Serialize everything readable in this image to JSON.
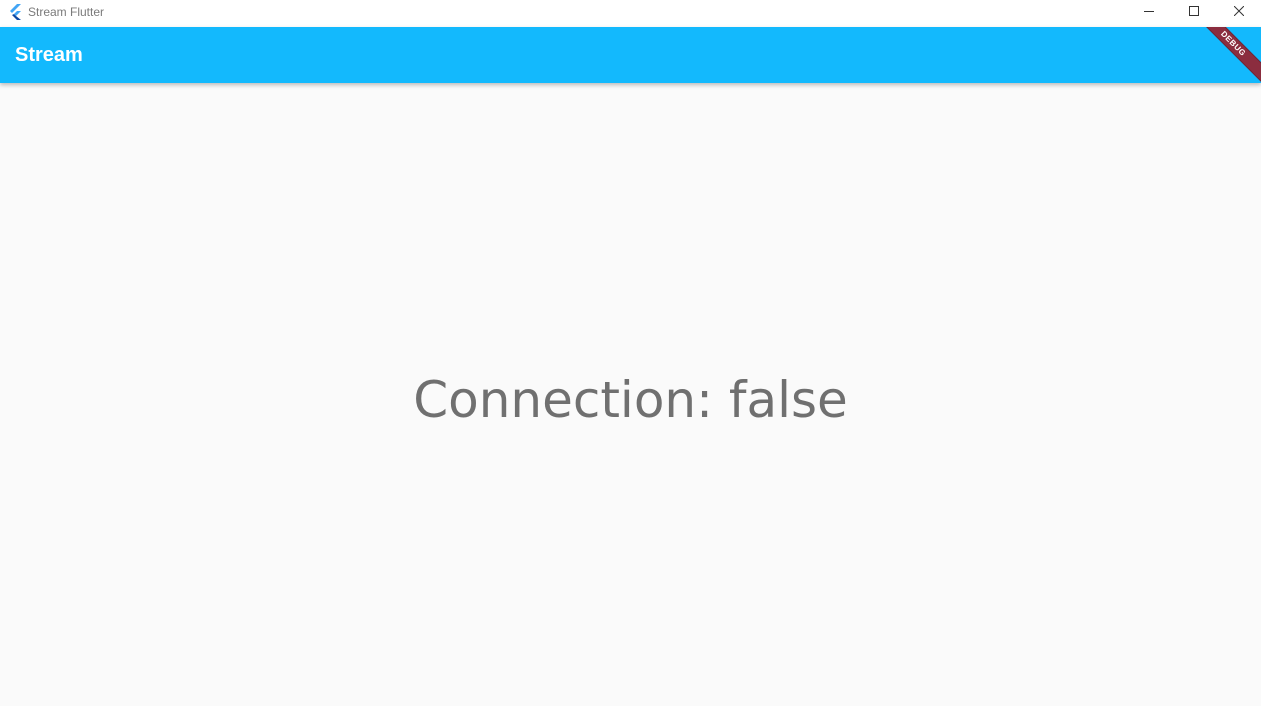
{
  "window": {
    "title": "Stream Flutter",
    "app_icon": "flutter-logo-icon",
    "controls": {
      "minimize_icon": "minimize-icon",
      "maximize_icon": "maximize-icon",
      "close_icon": "close-icon"
    }
  },
  "appbar": {
    "title": "Stream",
    "color": "#13b9fd",
    "debug_banner": "DEBUG"
  },
  "body": {
    "status_text": "Connection: false",
    "text_color": "#707070"
  }
}
